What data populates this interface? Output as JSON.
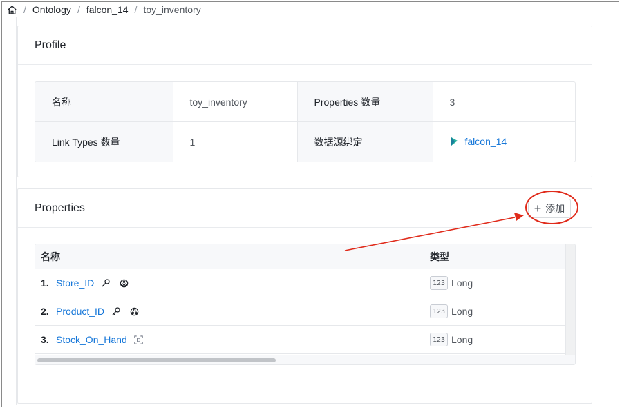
{
  "breadcrumb": {
    "items": [
      "Ontology",
      "falcon_14",
      "toy_inventory"
    ]
  },
  "profile": {
    "title": "Profile",
    "rows": [
      {
        "label1": "名称",
        "value1": "toy_inventory",
        "label2": "Properties 数量",
        "value2": "3"
      },
      {
        "label1": "Link Types 数量",
        "value1": "1",
        "label2": "数据源绑定",
        "value2": "falcon_14"
      }
    ]
  },
  "properties": {
    "title": "Properties",
    "add_label": "添加",
    "columns": {
      "name": "名称",
      "type": "类型"
    },
    "rows": [
      {
        "index": "1.",
        "name": "Store_ID",
        "icons": [
          "key-icon",
          "shared-property-icon"
        ],
        "type_badge": "123",
        "type": "Long"
      },
      {
        "index": "2.",
        "name": "Product_ID",
        "icons": [
          "key-icon",
          "shared-property-icon"
        ],
        "type_badge": "123",
        "type": "Long"
      },
      {
        "index": "3.",
        "name": "Stock_On_Hand",
        "icons": [
          "scan-icon"
        ],
        "type_badge": "123",
        "type": "Long"
      }
    ]
  },
  "colors": {
    "link": "#1677d9",
    "annotation": "#e02b1b",
    "border": "#e6e8eb"
  }
}
